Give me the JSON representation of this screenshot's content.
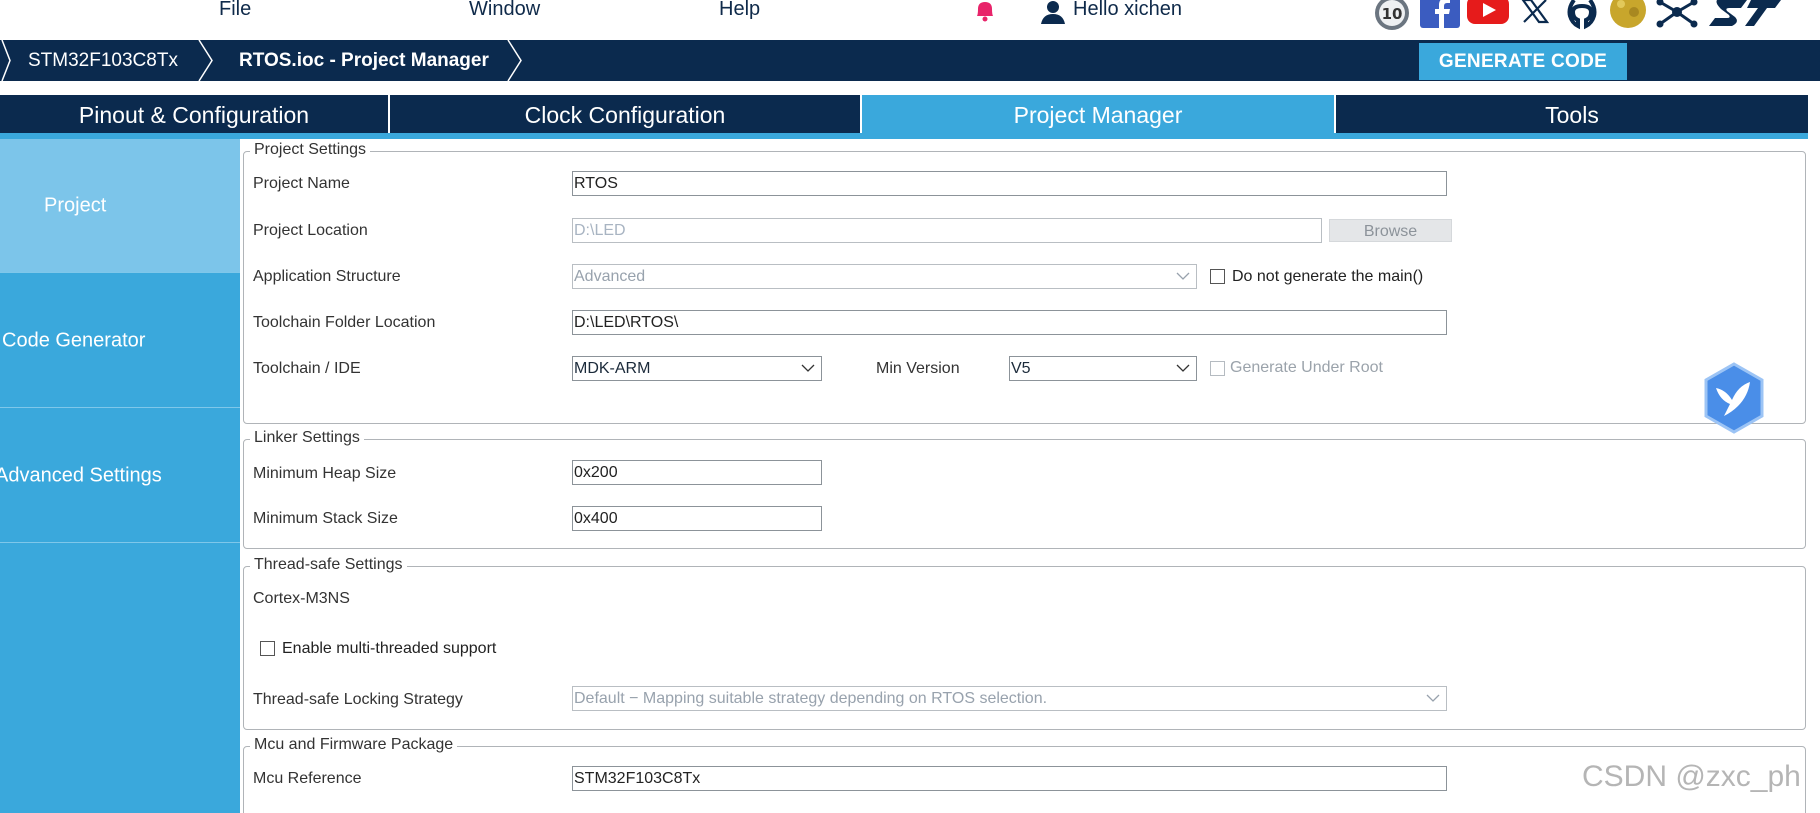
{
  "menu": {
    "file": "File",
    "window": "Window",
    "help": "Help",
    "greeting": "Hello xichen"
  },
  "breadcrumb": {
    "device": "STM32F103C8Tx",
    "project": "RTOS.ioc - Project Manager"
  },
  "actions": {
    "generate": "GENERATE CODE"
  },
  "tabs": [
    {
      "label": "Pinout & Configuration"
    },
    {
      "label": "Clock Configuration"
    },
    {
      "label": "Project Manager"
    },
    {
      "label": "Tools"
    }
  ],
  "sidebar": [
    {
      "label": "Project"
    },
    {
      "label": "Code Generator"
    },
    {
      "label": "Advanced Settings"
    }
  ],
  "project_settings": {
    "legend": "Project Settings",
    "name_label": "Project Name",
    "name_value": "RTOS",
    "location_label": "Project Location",
    "location_value": "D:\\LED",
    "browse": "Browse",
    "structure_label": "Application Structure",
    "structure_value": "Advanced",
    "no_main_label": "Do not generate the main()",
    "toolchain_folder_label": "Toolchain Folder Location",
    "toolchain_folder_value": "D:\\LED\\RTOS\\",
    "ide_label": "Toolchain / IDE",
    "ide_value": "MDK-ARM",
    "min_version_label": "Min Version",
    "min_version_value": "V5",
    "gen_root_label": "Generate Under Root"
  },
  "linker_settings": {
    "legend": "Linker Settings",
    "heap_label": "Minimum Heap Size",
    "heap_value": "0x200",
    "stack_label": "Minimum Stack Size",
    "stack_value": "0x400"
  },
  "thread_settings": {
    "legend": "Thread-safe Settings",
    "core": "Cortex-M3NS",
    "multithread_label": "Enable multi-threaded support",
    "strategy_label": "Thread-safe Locking Strategy",
    "strategy_value": "Default  −  Mapping suitable strategy depending on RTOS selection."
  },
  "mcu_package": {
    "legend": "Mcu and Firmware Package",
    "mcu_label": "Mcu Reference",
    "mcu_value": "STM32F103C8Tx"
  },
  "watermark": "CSDN @zxc_ph",
  "colors": {
    "navy": "#0b2a4e",
    "accent": "#3aa8dc",
    "accent_light": "#7cc5ea"
  },
  "icons": [
    "bell-icon",
    "user-icon",
    "version-10-icon",
    "facebook-icon",
    "youtube-icon",
    "x-icon",
    "github-icon",
    "community-icon",
    "network-icon",
    "st-logo-icon",
    "bird-badge-icon"
  ]
}
